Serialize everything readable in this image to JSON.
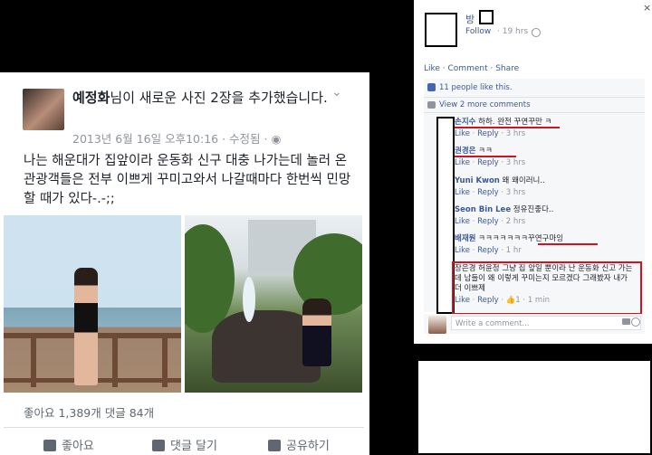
{
  "left_post": {
    "author": "예정화",
    "headline_rest": "님이 새로운 사진 2장을 추가했습니다.",
    "date": "2013년 6월 16일 오후10:16 · 수정됨 · ",
    "body": "나는 해운대가 집앞이라 운동화 신구 대충 나가는데 놀러 온 관광객들은 전부 이쁘게 꾸미고와서 나갈때마다 한번씩 민망할 때가 있다-.-;;",
    "stats": "좋아요 1,389개   댓글 84개",
    "actions": [
      "좋아요",
      "댓글 달기",
      "공유하기"
    ]
  },
  "right_post": {
    "name_prefix": "방",
    "follow": "Follow",
    "time": "· 19 hrs ·",
    "close": "×",
    "actions": "Like · Comment · Share",
    "likes": "11 people like this.",
    "previous": "View 2 more comments",
    "comments": [
      {
        "user": "손지수",
        "text": "하하. 완전 꾸연꾸만 ㅋ",
        "meta_likes": "Like",
        "meta_reply": "Reply",
        "time": "· 3 hrs"
      },
      {
        "user": "권경은",
        "text": "ㅋㅋ",
        "meta_likes": "Like",
        "meta_reply": "Reply",
        "time": "· 3 hrs"
      },
      {
        "user": "Yuni Kwon",
        "text": "왜 왜이러니..",
        "meta_likes": "Like",
        "meta_reply": "Reply",
        "time": "· 3 hrs"
      },
      {
        "user": "Seon Bin Lee",
        "text": "정유진좋다..",
        "meta_likes": "Like",
        "meta_reply": "Reply",
        "time": "· 2 hrs"
      },
      {
        "user": "배재원",
        "text": "ㅋㅋㅋㅋㅋㅋㅋ꾸연구마잉",
        "meta_likes": "Like",
        "meta_reply": "Reply",
        "time": "· 1 hr"
      },
      {
        "user": "",
        "text": "장은경 허윤정 그냥 집 앞일 뿐이라 난 운동화 신고 가는데 남들이 왜 이렇게 꾸미는지 모르겠다 그래봤자 내가 더 이쁘제",
        "meta_likes": "Like",
        "meta_reply": "Reply",
        "time": "· 👍1 · 1 min"
      }
    ],
    "write_placeholder": "Write a comment..."
  },
  "colors": {
    "link": "#3b5998",
    "highlight": "#d4111f"
  }
}
